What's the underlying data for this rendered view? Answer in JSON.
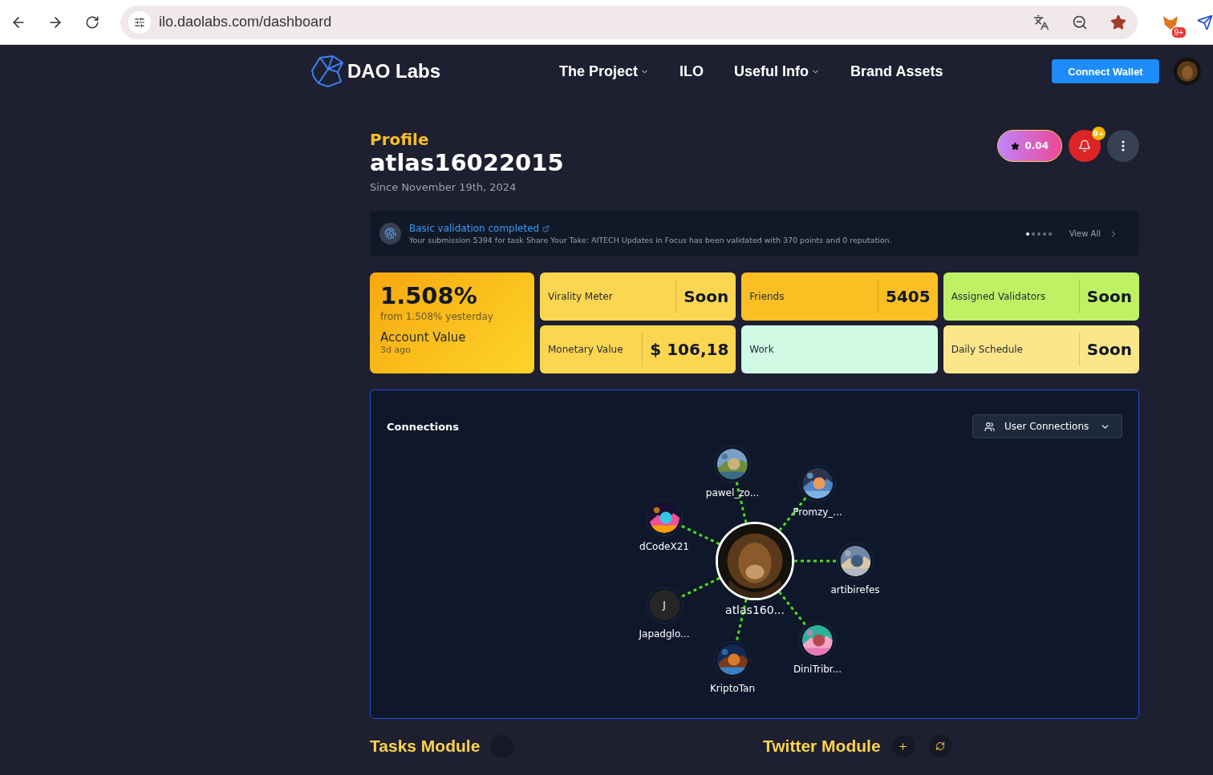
{
  "browser": {
    "url": "ilo.daolabs.com/dashboard",
    "extension_badge": "9+"
  },
  "nav": {
    "brand": "DAO Labs",
    "links": [
      {
        "label": "The Project",
        "dropdown": true
      },
      {
        "label": "ILO",
        "dropdown": false
      },
      {
        "label": "Useful Info",
        "dropdown": true
      },
      {
        "label": "Brand Assets",
        "dropdown": false
      }
    ],
    "connect_button": "Connect Wallet"
  },
  "profile": {
    "section": "Profile",
    "username": "atlas16022015",
    "since": "Since November 19th, 2024",
    "points": "0.04",
    "notification_badge": "9+"
  },
  "notification": {
    "title": "Basic validation completed",
    "message": "Your submission 5394 for task Share Your Take: AITECH Updates in Focus has been validated with 370 points and 0 reputation.",
    "view_all": "View All",
    "dots": [
      {
        "selected": true
      },
      {
        "selected": false
      },
      {
        "selected": false
      },
      {
        "selected": false
      },
      {
        "selected": false
      }
    ]
  },
  "account": {
    "value": "1.508%",
    "change": "from 1.508% yesterday",
    "label": "Account Value",
    "time": "3d ago"
  },
  "stats": [
    {
      "label": "Virality Meter",
      "value": "Soon",
      "color": "#fdd651"
    },
    {
      "label": "Friends",
      "value": "5405",
      "color": "#fbbf24"
    },
    {
      "label": "Assigned Validators",
      "value": "Soon",
      "color": "#bef264"
    },
    {
      "label": "Monetary Value",
      "value": "$ 106,18",
      "color": "#fdd651"
    },
    {
      "label": "Work",
      "color": "#d1fae5"
    },
    {
      "label": "Daily Schedule",
      "value": "Soon",
      "color": "#fde68a"
    }
  ],
  "connections": {
    "title": "Connections",
    "filter": "User Connections",
    "center": "atlas160...",
    "nodes": [
      {
        "name": "pawel_zo...",
        "kind": "picture"
      },
      {
        "name": "Promzy_...",
        "kind": "picture"
      },
      {
        "name": "dCodeX21",
        "kind": "picture"
      },
      {
        "name": "artibirefes",
        "kind": "picture"
      },
      {
        "name": "Japadglo...",
        "kind": "initial",
        "initial": "J"
      },
      {
        "name": "KriptoTan",
        "kind": "picture"
      },
      {
        "name": "DiniTribr...",
        "kind": "picture"
      }
    ]
  },
  "modules": [
    {
      "title": "Tasks Module",
      "kind": "tasks"
    },
    {
      "title": "Twitter Module",
      "kind": "twitter"
    }
  ]
}
